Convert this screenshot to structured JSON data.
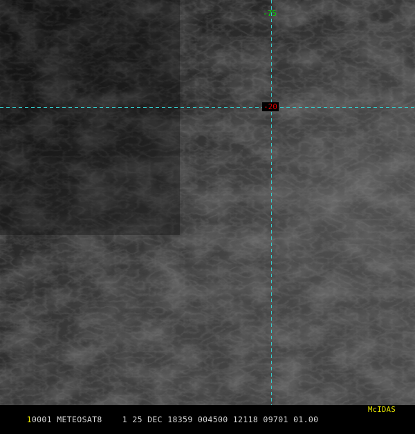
{
  "image": {
    "description_colors": {
      "background": "#1b1b1b",
      "grid_line": "#33cccc",
      "longitude_label": "#00e000",
      "latitude_label": "#e00000",
      "status_text": "#d8d8d8",
      "frame_number": "#e8e800",
      "logo": "#e8e800"
    }
  },
  "grid": {
    "longitude_label": "-75",
    "latitude_label": "-20"
  },
  "status_bar": {
    "frame_number": "1",
    "text": "0001 METEOSAT8    1 25 DEC 18359 004500 12118 09701 01.00",
    "logo": "McIDAS"
  }
}
